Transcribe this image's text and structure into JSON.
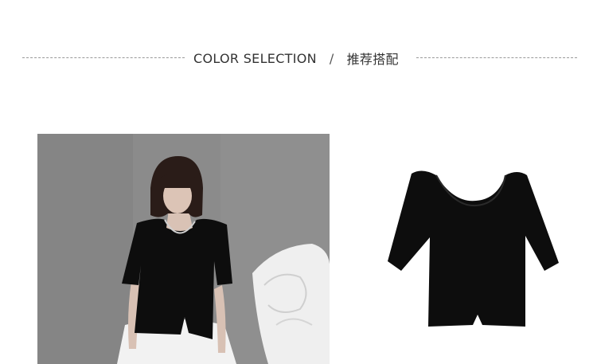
{
  "section_header": {
    "english": "COLOR SELECTION",
    "separator": "/",
    "chinese": "推荐搭配"
  },
  "images": {
    "model_photo": "model-wearing-black-top",
    "product_photo": "black-scoop-neck-top"
  },
  "colors": {
    "shirt": "#0d0d0d",
    "background_wall": "#8a8a8a",
    "rule": "#9a9a9a",
    "text": "#333333"
  }
}
